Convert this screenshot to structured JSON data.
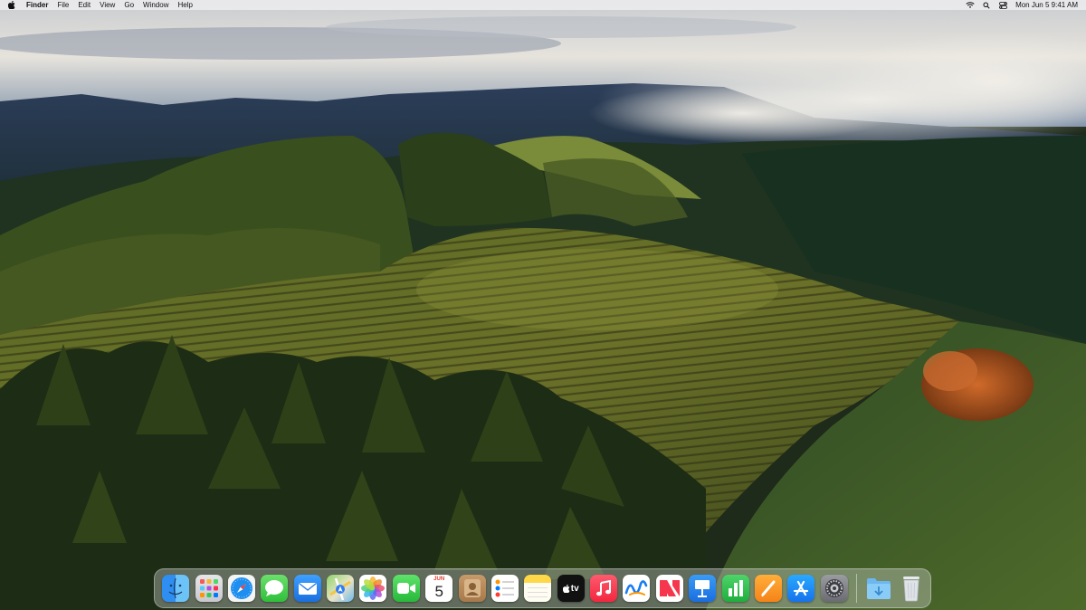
{
  "menubar": {
    "app_name": "Finder",
    "menus": [
      "File",
      "Edit",
      "View",
      "Go",
      "Window",
      "Help"
    ],
    "status_icons": [
      "wifi-icon",
      "search-icon",
      "control-center-icon"
    ],
    "clock": "Mon Jun 5  9:41 AM"
  },
  "dock": {
    "apps": [
      {
        "name": "Finder",
        "icon": "finder-icon"
      },
      {
        "name": "Launchpad",
        "icon": "launchpad-icon"
      },
      {
        "name": "Safari",
        "icon": "safari-icon"
      },
      {
        "name": "Messages",
        "icon": "messages-icon"
      },
      {
        "name": "Mail",
        "icon": "mail-icon"
      },
      {
        "name": "Maps",
        "icon": "maps-icon"
      },
      {
        "name": "Photos",
        "icon": "photos-icon"
      },
      {
        "name": "FaceTime",
        "icon": "facetime-icon"
      },
      {
        "name": "Calendar",
        "icon": "calendar-icon",
        "month": "JUN",
        "day": "5"
      },
      {
        "name": "Contacts",
        "icon": "contacts-icon"
      },
      {
        "name": "Reminders",
        "icon": "reminders-icon"
      },
      {
        "name": "Notes",
        "icon": "notes-icon"
      },
      {
        "name": "TV",
        "icon": "tv-icon",
        "label": "tv"
      },
      {
        "name": "Music",
        "icon": "music-icon"
      },
      {
        "name": "Freeform",
        "icon": "freeform-icon"
      },
      {
        "name": "News",
        "icon": "news-icon"
      },
      {
        "name": "Keynote",
        "icon": "keynote-icon"
      },
      {
        "name": "Numbers",
        "icon": "numbers-icon"
      },
      {
        "name": "Pages",
        "icon": "pages-icon"
      },
      {
        "name": "App Store",
        "icon": "app-store-icon"
      },
      {
        "name": "System Settings",
        "icon": "settings-icon"
      }
    ],
    "stacks": [
      {
        "name": "Downloads",
        "icon": "downloads-folder-icon"
      },
      {
        "name": "Trash",
        "icon": "trash-icon"
      }
    ]
  }
}
